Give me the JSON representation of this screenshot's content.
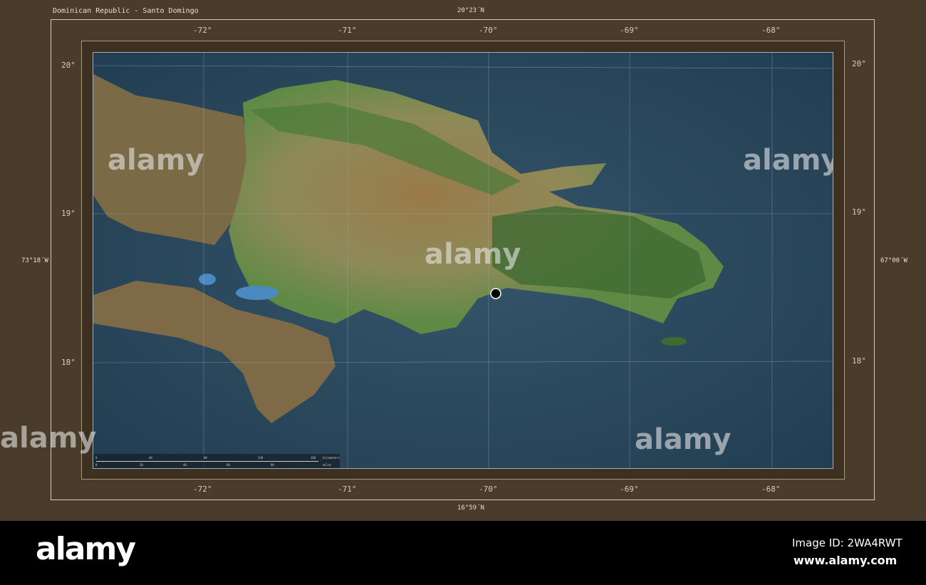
{
  "title": "Dominican Republic - Santo Domingo",
  "top_lat": "20°23´N",
  "bottom_lat": "16°59´N",
  "west_lon": "73°18´W",
  "east_lon": "67°00´W",
  "lon_ticks": [
    "-72°",
    "-71°",
    "-70°",
    "-69°",
    "-68°"
  ],
  "lat_ticks": [
    "20°",
    "19°",
    "18°"
  ],
  "scale": {
    "km_labels": [
      "0",
      "40",
      "80",
      "120",
      "160"
    ],
    "km_unit": "kilometers",
    "mi_labels": [
      "0",
      "20",
      "40",
      "60",
      "80"
    ],
    "mi_unit": "miles"
  },
  "marker": {
    "name": "Santo Domingo",
    "lon": -69.93,
    "lat": 18.47
  },
  "watermark": "alamy",
  "footer": {
    "logo": "alamy",
    "image_id": "Image ID: 2WA4RWT",
    "site": "www.alamy.com"
  },
  "colors": {
    "frame": "#4a3c2a",
    "sea": "#2c4a5e",
    "land": "#5f8a45",
    "highland": "#a08a5a"
  }
}
